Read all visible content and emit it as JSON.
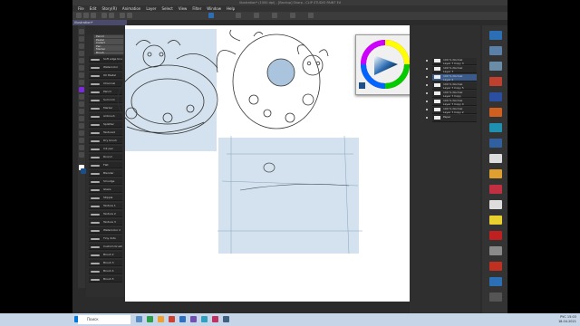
{
  "window": {
    "title": "illustration* (1500 dpi) - [Backup] Sharp - CLIP STUDIO PAINT EX"
  },
  "menu": [
    "File",
    "Edit",
    "Story(R)",
    "Animation",
    "Layer",
    "Select",
    "View",
    "Filter",
    "Window",
    "Help"
  ],
  "doc_tab": "illustration*",
  "subtool_tabs": [
    "Pencil",
    "Pastel",
    "Cellart",
    "Pen",
    "Marker",
    "Brush"
  ],
  "brushes": [
    "Soft edge brush",
    "Watercolor",
    "Oil Pastel",
    "Charcoal",
    "Pencil",
    "Sumi ink",
    "Marker",
    "Airbrush",
    "Splatter",
    "Textured",
    "Dry brush",
    "Ink pen",
    "Round",
    "Flat",
    "Blender",
    "Smudge",
    "Glaze",
    "Stipple",
    "Texture 1",
    "Texture 2",
    "Texture 3",
    "Watercolor 2",
    "Tiny dots",
    "Custom brush",
    "Brush 2",
    "Brush 3",
    "Brush 4",
    "Brush 5"
  ],
  "layers": [
    {
      "name": "100 % Normal",
      "sub": "Layer 7 Copy 3"
    },
    {
      "name": "100 % Normal",
      "sub": "Layer 7"
    },
    {
      "name": "100 % Normal",
      "sub": "Layer 2",
      "selected": true
    },
    {
      "name": "100 % Normal",
      "sub": "Layer 7 Copy 5"
    },
    {
      "name": "100 % Normal",
      "sub": "Layer 7 Copy"
    },
    {
      "name": "100 % Normal",
      "sub": "Layer 7 Copy 4"
    },
    {
      "name": "100 % Normal",
      "sub": "Layer 7 Copy 2"
    },
    {
      "name": "Paper",
      "sub": ""
    }
  ],
  "right_tools": [
    "",
    "",
    "",
    "",
    "",
    "",
    "",
    "",
    "",
    "",
    "",
    "",
    "",
    "",
    "",
    "",
    "",
    ""
  ],
  "taskbar": {
    "search_placeholder": "Поиск",
    "time": "15:03",
    "date": "18.04.2021",
    "lang": "РУС"
  },
  "colors": {
    "accent_blue": "#3a5a8a",
    "paper": "#ffffff",
    "sketch_blue": "#d3e2ee"
  }
}
